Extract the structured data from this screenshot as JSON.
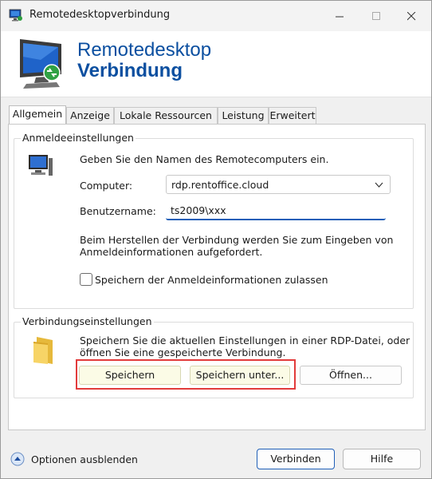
{
  "window": {
    "title": "Remotedesktopverbindung"
  },
  "banner": {
    "line1": "Remotedesktop",
    "line2": "Verbindung"
  },
  "tabs": [
    "Allgemein",
    "Anzeige",
    "Lokale Ressourcen",
    "Leistung",
    "Erweitert"
  ],
  "logon": {
    "group_label": "Anmeldeeinstellungen",
    "intro": "Geben Sie den Namen des Remotecomputers ein.",
    "computer_label": "Computer:",
    "computer_value": "rdp.rentoffice.cloud",
    "user_label": "Benutzername:",
    "user_value": "ts2009\\xxx",
    "info_line1": "Beim Herstellen der Verbindung werden Sie zum Eingeben von",
    "info_line2": "Anmeldeinformationen aufgefordert.",
    "save_credentials_label": "Speichern der Anmeldeinformationen zulassen",
    "save_credentials_checked": false
  },
  "connection": {
    "group_label": "Verbindungseinstellungen",
    "text_line1": "Speichern Sie die aktuellen Einstellungen in einer RDP-Datei, oder",
    "text_line2": "öffnen Sie eine gespeicherte Verbindung.",
    "save_button": "Speichern",
    "save_as_button": "Speichern unter...",
    "open_button": "Öffnen..."
  },
  "footer": {
    "options_label": "Optionen ausblenden",
    "connect_button": "Verbinden",
    "help_button": "Hilfe"
  },
  "icons": {
    "app": "remote-desktop-icon",
    "banner": "remote-desktop-monitor-icon",
    "computer": "computer-icon",
    "folder": "folder-icon",
    "options": "chevron-up-circle-icon"
  },
  "colors": {
    "accent": "#0b4fa0",
    "highlight": "#e23b3b",
    "yellow_button": "#fbfbe6"
  }
}
